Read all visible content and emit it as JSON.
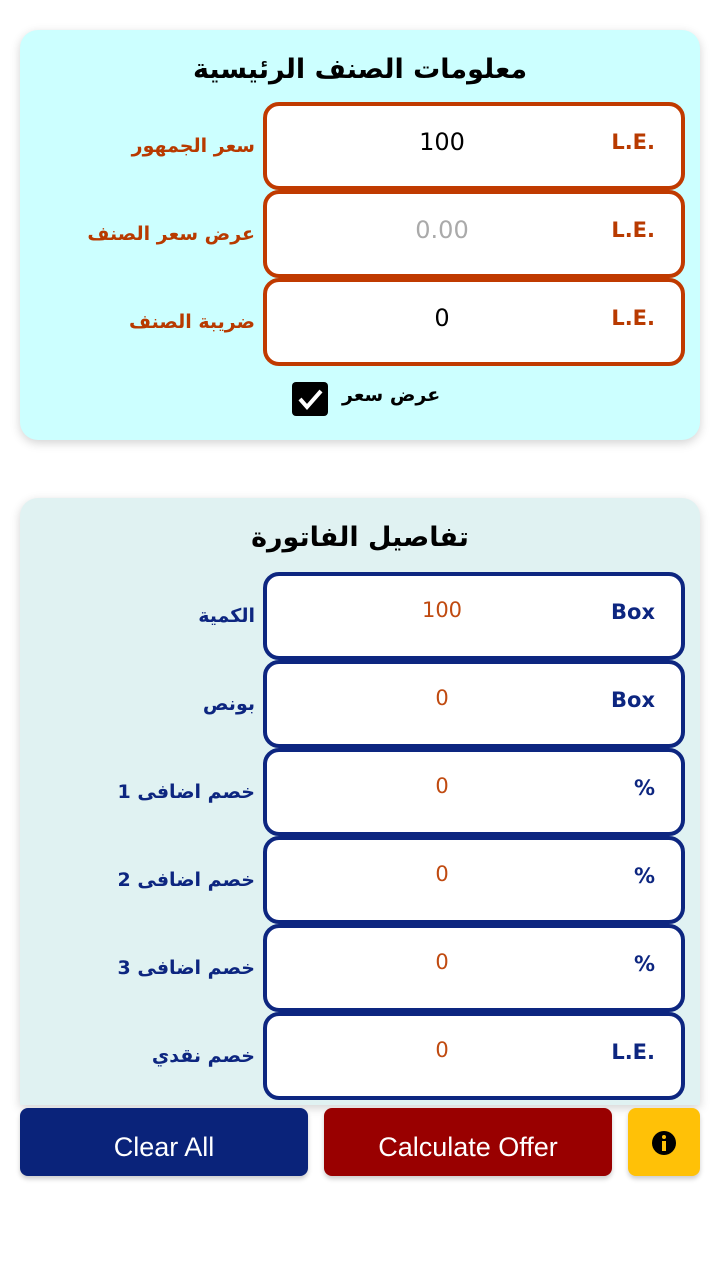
{
  "main_info": {
    "title": "معلومات الصنف الرئيسية",
    "fields": [
      {
        "label": "سعر الجمهور",
        "value": "100",
        "unit": "L.E."
      },
      {
        "label": "عرض سعر الصنف",
        "placeholder": "0.00",
        "unit": "L.E."
      },
      {
        "label": "ضريبة الصنف",
        "value": "0",
        "unit": "L.E."
      }
    ],
    "checkbox": {
      "label": "عرض سعر",
      "checked": true
    }
  },
  "invoice": {
    "title": "تفاصيل الفاتورة",
    "fields": [
      {
        "label": "الكمية",
        "value": "100",
        "unit": "Box"
      },
      {
        "label": "بونص",
        "value": "0",
        "unit": "Box"
      },
      {
        "label": "خصم اضافى 1",
        "value": "0",
        "unit": "%"
      },
      {
        "label": "خصم اضافى 2",
        "value": "0",
        "unit": "%"
      },
      {
        "label": "خصم اضافى 3",
        "value": "0",
        "unit": "%"
      },
      {
        "label": "خصم نقدي",
        "value": "0",
        "unit": "L.E."
      }
    ]
  },
  "buttons": {
    "clear": "Clear All",
    "calculate": "Calculate Offer",
    "info_icon": "info-icon"
  },
  "colors": {
    "orange_border": "#c03a00",
    "navy": "#0d2680",
    "red_button": "#990000",
    "yellow_button": "#ffc107"
  }
}
